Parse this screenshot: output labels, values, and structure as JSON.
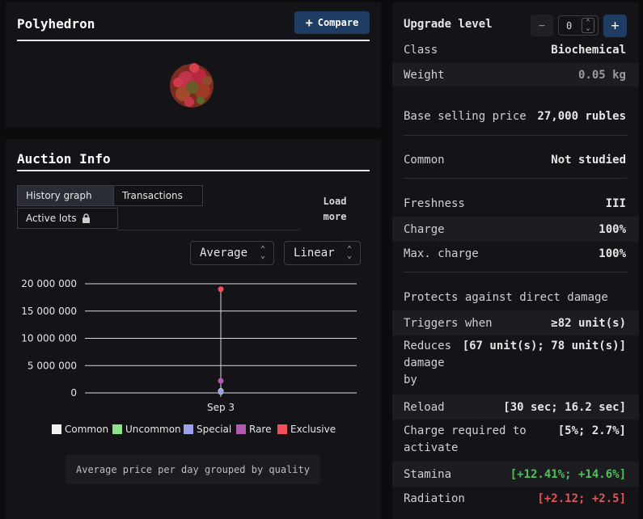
{
  "item": {
    "name": "Polyhedron",
    "compare_label": "Compare"
  },
  "auction": {
    "title": "Auction Info",
    "tabs": [
      "History graph",
      "Transactions",
      "Active lots"
    ],
    "load_more": "Load more",
    "aggregate_select": "Average",
    "scale_select": "Linear",
    "caption": "Average price per day grouped by quality"
  },
  "chart_data": {
    "type": "scatter",
    "x": [
      "Sep 3"
    ],
    "y_ticks": [
      "20 000 000",
      "15 000 000",
      "10 000 000",
      "5 000 000",
      "0"
    ],
    "ylim": [
      0,
      20000000
    ],
    "series": [
      {
        "name": "Common",
        "color": "#f0f0f0",
        "values": [
          350000
        ]
      },
      {
        "name": "Uncommon",
        "color": "#8fe08a",
        "values": [
          150000
        ]
      },
      {
        "name": "Special",
        "color": "#9ea0ee",
        "values": [
          250000
        ]
      },
      {
        "name": "Rare",
        "color": "#b05ab0",
        "values": [
          2200000
        ]
      },
      {
        "name": "Exclusive",
        "color": "#f0505a",
        "values": [
          19000000
        ]
      }
    ]
  },
  "stats": {
    "upgrade_label": "Upgrade level",
    "upgrade_value": "0",
    "minus": "−",
    "plus": "+",
    "rows": [
      {
        "k": "Class",
        "v": "Biochemical"
      },
      {
        "k": "Weight",
        "v": "0.05 kg"
      },
      {
        "k": "Base selling price",
        "v": "27,000 rubles"
      },
      {
        "k": "Common",
        "v": "Not studied"
      },
      {
        "k": "Freshness",
        "v": "III"
      },
      {
        "k": "Charge",
        "v": "100%"
      },
      {
        "k": "Max. charge",
        "v": "100%"
      },
      {
        "k": "Protects against direct damage",
        "v": ""
      },
      {
        "k": "Triggers when",
        "v": "≥82 unit(s)"
      },
      {
        "k": "Reduces damage by",
        "v": "[67 unit(s); 78 unit(s)]"
      },
      {
        "k": "Reload",
        "v": "[30 sec; 16.2 sec]"
      },
      {
        "k": "Charge required to activate",
        "v": "[5%; 2.7%]"
      },
      {
        "k": "Stamina",
        "v": "[+12.41%; +14.6%]"
      },
      {
        "k": "Radiation",
        "v": "[+2.12; +2.5]"
      }
    ]
  }
}
